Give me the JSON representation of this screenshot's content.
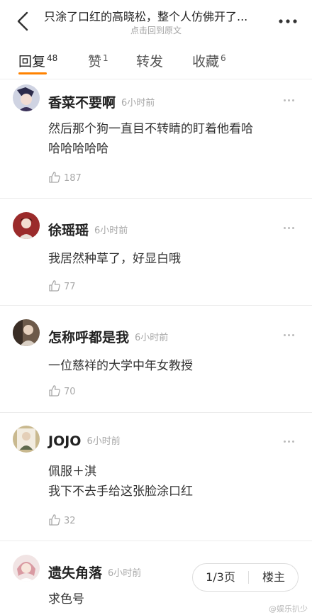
{
  "header": {
    "title": "只涂了口红的高晓松，整个人仿佛开了...",
    "subtitle": "点击回到原文"
  },
  "tabs": [
    {
      "label": "回复",
      "count": "48"
    },
    {
      "label": "赞",
      "count": "1"
    },
    {
      "label": "转发",
      "count": ""
    },
    {
      "label": "收藏",
      "count": "6"
    }
  ],
  "comments": [
    {
      "username": "香菜不要啊",
      "time": "6小时前",
      "lines": [
        "然后那个狗一直目不转睛的盯着他看哈",
        "哈哈哈哈哈"
      ],
      "likes": "187"
    },
    {
      "username": "徐瑶瑶",
      "time": "6小时前",
      "lines": [
        "我居然种草了，好显白哦"
      ],
      "likes": "77"
    },
    {
      "username": "怎称呼都是我",
      "time": "6小时前",
      "lines": [
        "一位慈祥的大学中年女教授"
      ],
      "likes": "70"
    },
    {
      "username": "JOJO",
      "time": "6小时前",
      "lines": [
        "佩服＋淇",
        "我下不去手给这张脸涂口红"
      ],
      "likes": "32"
    },
    {
      "username": "遗失角落",
      "time": "6小时前",
      "lines": [
        "求色号"
      ],
      "likes": ""
    }
  ],
  "pager": {
    "page": "1/3页",
    "floor": "楼主"
  },
  "watermark": "@娱乐扒少",
  "colors": {
    "accent": "#ff8200",
    "text": "#333333",
    "muted": "#a8a8a8"
  }
}
